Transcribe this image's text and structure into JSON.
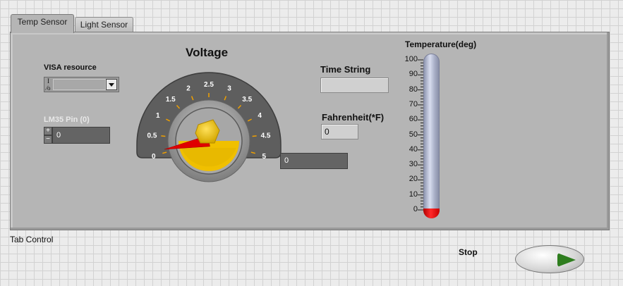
{
  "tabs": [
    {
      "label": "Temp Sensor",
      "active": true
    },
    {
      "label": "Light Sensor",
      "active": false
    }
  ],
  "tab_control_label": "Tab Control",
  "visa": {
    "label": "VISA resource",
    "io_symbol": "I/O",
    "value": ""
  },
  "lm35": {
    "label": "LM35 Pin (0)",
    "value": "0",
    "increment_icon": "plus-icon",
    "decrement_icon": "minus-icon"
  },
  "voltage": {
    "title": "Voltage",
    "min": 0,
    "max": 5,
    "value": 0.1,
    "scale_labels": [
      "0",
      "0.5",
      "1",
      "1.5",
      "2",
      "2.5",
      "3",
      "3.5",
      "4",
      "4.5",
      "5"
    ],
    "digital_display": "0",
    "needle_color": "#e00000",
    "knob_color": "#f2c500"
  },
  "time_string": {
    "label": "Time String",
    "value": ""
  },
  "fahrenheit": {
    "label": "Fahrenheit(*F)",
    "value": "0"
  },
  "temperature": {
    "label": "Temperature(deg)",
    "min": 0,
    "max": 100,
    "value": 0,
    "scale_labels": [
      "100",
      "90",
      "80",
      "70",
      "60",
      "50",
      "40",
      "30",
      "20",
      "10",
      "0"
    ],
    "fill_color": "#e00000"
  },
  "stop": {
    "label": "Stop",
    "icon": "play-arrow-icon"
  },
  "colors": {
    "panel": "#b5b5b5",
    "background": "#ececec",
    "indicator_dark": "#646464"
  }
}
